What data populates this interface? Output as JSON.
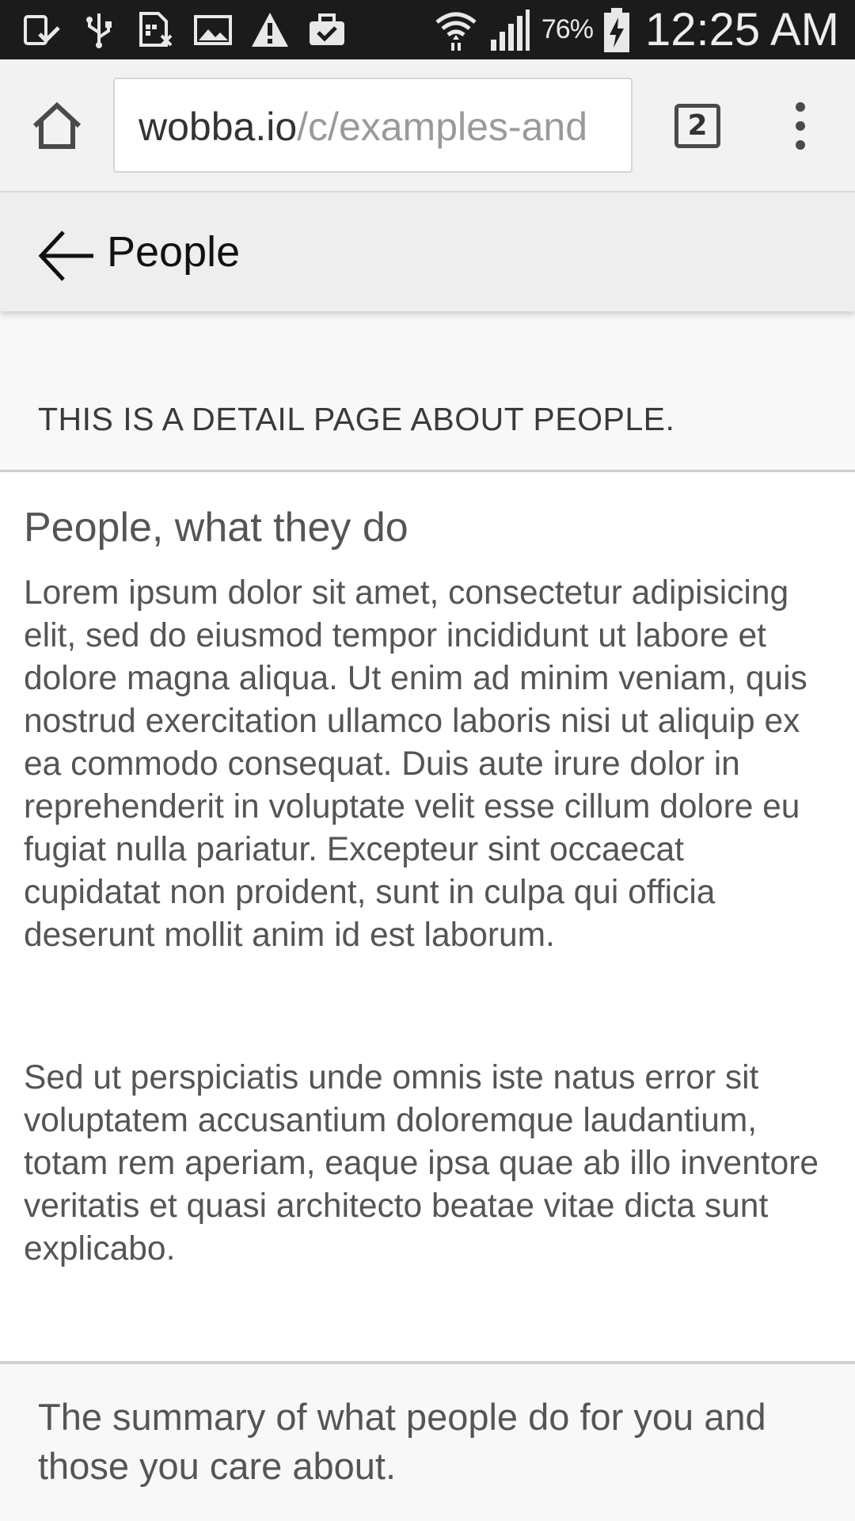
{
  "status_bar": {
    "left_icons": [
      "download-done-icon",
      "usb-icon",
      "sim-error-icon",
      "image-icon",
      "warning-icon",
      "briefcase-check-icon"
    ],
    "right_icons": [
      "wifi-icon",
      "signal-icon",
      "battery-charging-icon"
    ],
    "battery": "76%",
    "time": "12:25 AM"
  },
  "browser": {
    "url_domain": "wobba.io",
    "url_path": "/c/examples-and",
    "tab_count": "2",
    "icons": [
      "home-icon",
      "more-vert-icon"
    ]
  },
  "header": {
    "title": "People",
    "back_icon": "arrow-back-icon"
  },
  "banner": {
    "text": "THIS IS A DETAIL PAGE ABOUT PEOPLE."
  },
  "content": {
    "title": "People, what they do",
    "paragraph1": "Lorem ipsum dolor sit amet, consectetur adipisicing elit, sed do eiusmod tempor incididunt ut labore et dolore magna aliqua. Ut enim ad minim veniam, quis nostrud exercitation ullamco laboris nisi ut aliquip ex ea commodo consequat. Duis aute irure dolor in reprehenderit in voluptate velit esse cillum dolore eu fugiat nulla pariatur. Excepteur sint occaecat cupidatat non proident, sunt in culpa qui officia deserunt mollit anim id est laborum.",
    "paragraph2": "Sed ut perspiciatis unde omnis iste natus error sit voluptatem accusantium doloremque laudantium, totam rem aperiam, eaque ipsa quae ab illo inventore veritatis et quasi architecto beatae vitae dicta sunt explicabo."
  },
  "footer": {
    "summary": "The summary of what people do for you and those you care about."
  },
  "colors": {
    "status_bar_bg": "#1b1b1b",
    "toolbar_bg": "#f2f2f2",
    "header_bg": "#eeeeee",
    "body_text": "#555555"
  }
}
